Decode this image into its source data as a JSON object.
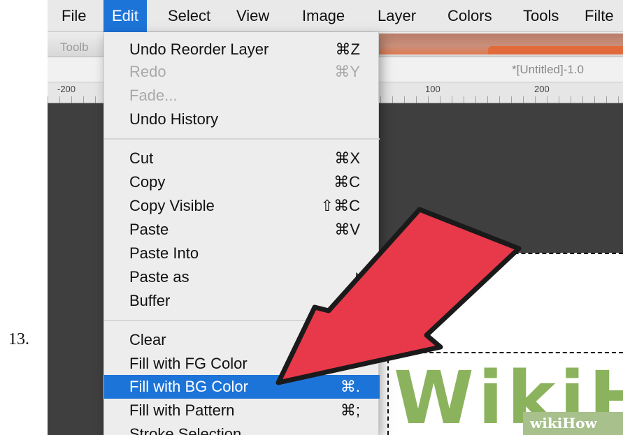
{
  "step_number": "13.",
  "menubar": {
    "items": [
      {
        "label": "File"
      },
      {
        "label": "Edit",
        "active": true
      },
      {
        "label": "Select"
      },
      {
        "label": "View"
      },
      {
        "label": "Image"
      },
      {
        "label": "Layer"
      },
      {
        "label": "Colors"
      },
      {
        "label": "Tools"
      },
      {
        "label": "Filte"
      }
    ]
  },
  "background": {
    "toolbox_label": "Toolb",
    "window_title": "*[Untitled]-1.0",
    "ruler_labels": [
      "-200",
      "100",
      "200"
    ],
    "watermark": "wikiHow"
  },
  "edit_menu": {
    "items": [
      {
        "label": "Undo Reorder Layer",
        "shortcut": "⌘Z",
        "enabled": true
      },
      {
        "label": "Redo",
        "shortcut": "⌘Y",
        "enabled": false
      },
      {
        "label": "Fade...",
        "shortcut": "",
        "enabled": false
      },
      {
        "label": "Undo History",
        "shortcut": "",
        "enabled": true
      },
      {
        "label": "Cut",
        "shortcut": "⌘X",
        "enabled": true
      },
      {
        "label": "Copy",
        "shortcut": "⌘C",
        "enabled": true
      },
      {
        "label": "Copy Visible",
        "shortcut": "⇧⌘C",
        "enabled": true
      },
      {
        "label": "Paste",
        "shortcut": "⌘V",
        "enabled": true
      },
      {
        "label": "Paste Into",
        "shortcut": "",
        "enabled": true
      },
      {
        "label": "Paste as",
        "shortcut": "",
        "enabled": true,
        "submenu": true
      },
      {
        "label": "Buffer",
        "shortcut": "",
        "enabled": true
      },
      {
        "label": "Clear",
        "shortcut": "",
        "enabled": true
      },
      {
        "label": "Fill with FG Color",
        "shortcut": "",
        "enabled": true
      },
      {
        "label": "Fill with BG Color",
        "shortcut": "⌘.",
        "enabled": true,
        "highlighted": true
      },
      {
        "label": "Fill with Pattern",
        "shortcut": "⌘;",
        "enabled": true
      },
      {
        "label": "Stroke Selection",
        "shortcut": "",
        "enabled": true
      }
    ]
  },
  "colors": {
    "highlight": "#1d74d8",
    "menu_bg": "#ededed",
    "arrow": "#e8394a",
    "logo_green": "#8bb35d"
  }
}
